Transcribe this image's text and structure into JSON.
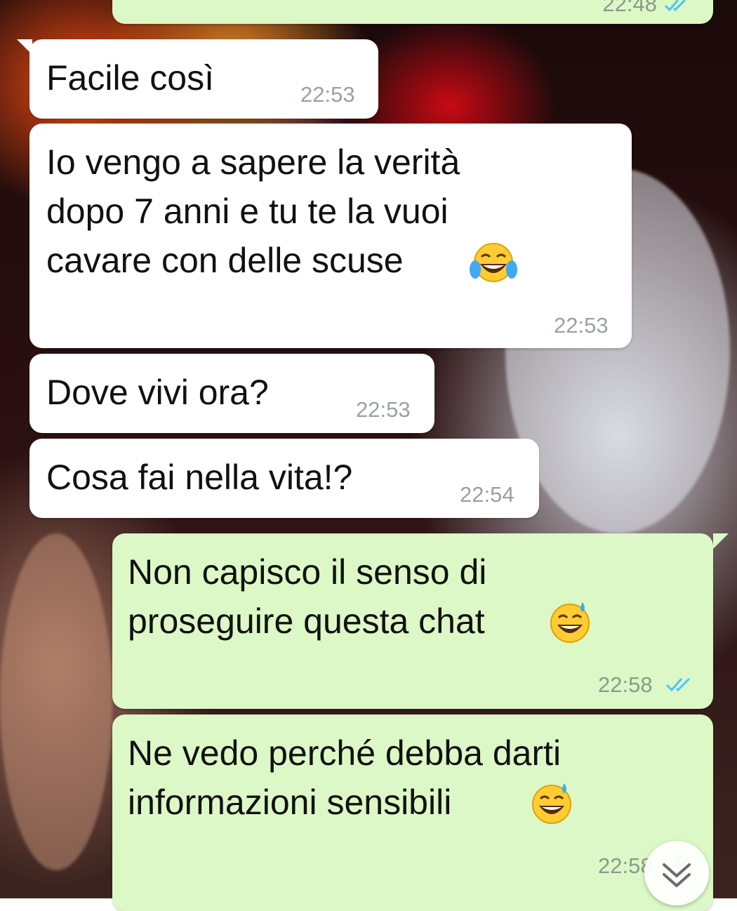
{
  "messages": [
    {
      "id": "m0",
      "direction": "outgoing",
      "text": "",
      "time": "22:48",
      "read": true,
      "partial": true
    },
    {
      "id": "m1",
      "direction": "incoming",
      "text": "Facile così",
      "time": "22:53"
    },
    {
      "id": "m2",
      "direction": "incoming",
      "lines": [
        "Io vengo a sapere la verità",
        "dopo 7 anni e tu te la vuoi",
        "cavare con delle scuse"
      ],
      "emoji": "face-with-tears-of-joy",
      "time": "22:53"
    },
    {
      "id": "m3",
      "direction": "incoming",
      "text": "Dove vivi ora?",
      "time": "22:53"
    },
    {
      "id": "m4",
      "direction": "incoming",
      "text": "Cosa fai nella vita!?",
      "time": "22:54"
    },
    {
      "id": "m5",
      "direction": "outgoing",
      "lines": [
        "Non capisco il senso di",
        "proseguire questa chat"
      ],
      "emoji": "grinning-face-with-sweat",
      "time": "22:58",
      "read": true
    },
    {
      "id": "m6",
      "direction": "outgoing",
      "lines": [
        "Ne vedo perché debba darti",
        "informazioni sensibili"
      ],
      "emoji": "grinning-face-with-sweat",
      "time": "22:58",
      "read": true
    }
  ],
  "scroll_button": {
    "icon": "double-chevron-down-icon"
  },
  "colors": {
    "incoming_bubble": "#ffffff",
    "outgoing_bubble": "#dcf8c6",
    "read_ticks": "#4fc3f7"
  }
}
